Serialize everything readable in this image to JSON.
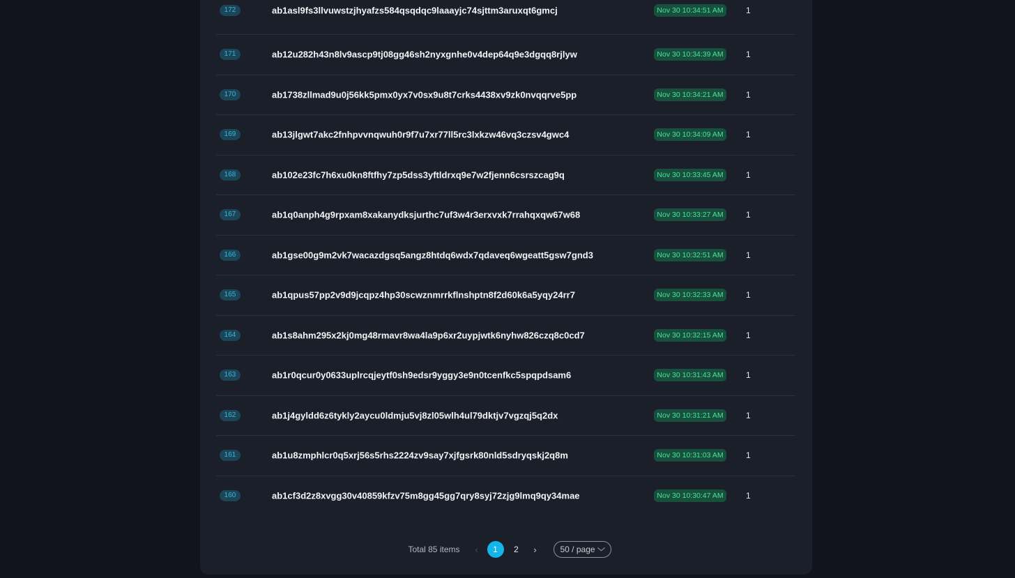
{
  "blocks": [
    {
      "height": "172",
      "hash": "ab1asl9fs3llvuwstzjhyafzs584qsqdqc9laaayjc74sjttm3aruxqt6gmcj",
      "time": "Nov 30 10:34:51 AM",
      "txs": "1"
    },
    {
      "height": "171",
      "hash": "ab12u282h43n8lv9ascp9tj08gg46sh2nyxgnhe0v4dep64q9e3dgqq8rjlyw",
      "time": "Nov 30 10:34:39 AM",
      "txs": "1"
    },
    {
      "height": "170",
      "hash": "ab1738zllmad9u0j56kk5pmx0yx7v0sx9u8t7crks4438xv9zk0nvqqrve5pp",
      "time": "Nov 30 10:34:21 AM",
      "txs": "1"
    },
    {
      "height": "169",
      "hash": "ab13jlgwt7akc2fnhpvvnqwuh0r9f7u7xr77ll5rc3lxkzw46vq3czsv4gwc4",
      "time": "Nov 30 10:34:09 AM",
      "txs": "1"
    },
    {
      "height": "168",
      "hash": "ab102e23fc7h6xu0kn8ftfhy7zp5dss3yftldrxq9e7w2fjenn6csrszcag9q",
      "time": "Nov 30 10:33:45 AM",
      "txs": "1"
    },
    {
      "height": "167",
      "hash": "ab1q0anph4g9rpxam8xakanydksjurthc7uf3w4r3erxvxk7rrahqxqw67w68",
      "time": "Nov 30 10:33:27 AM",
      "txs": "1"
    },
    {
      "height": "166",
      "hash": "ab1gse00g9m2vk7wacazdgsq5angz8htdq6wdx7qdaveq6wgeatt5gsw7gnd3",
      "time": "Nov 30 10:32:51 AM",
      "txs": "1"
    },
    {
      "height": "165",
      "hash": "ab1qpus57pp2v9d9jcqpz4hp30scwznmrrkflnshptn8f2d60k6a5yqy24rr7",
      "time": "Nov 30 10:32:33 AM",
      "txs": "1"
    },
    {
      "height": "164",
      "hash": "ab1s8ahm295x2kj0mg48rmavr8wa4la9p6xr2uypjwtk6nyhw826czq8c0cd7",
      "time": "Nov 30 10:32:15 AM",
      "txs": "1"
    },
    {
      "height": "163",
      "hash": "ab1r0qcur0y0633uplrcqjeytf0sh9edsr9yggy3e9n0tcenfkc5spqpdsam6",
      "time": "Nov 30 10:31:43 AM",
      "txs": "1"
    },
    {
      "height": "162",
      "hash": "ab1j4gyldd6z6tykly2aycu0ldmju5vj8zl05wlh4ul79dktjv7vgzqj5q2dx",
      "time": "Nov 30 10:31:21 AM",
      "txs": "1"
    },
    {
      "height": "161",
      "hash": "ab1u8zmphlcr0q5xrj56s5rhs2224zv9say7xjfgsrk80nld5sdryqskj2q8m",
      "time": "Nov 30 10:31:03 AM",
      "txs": "1"
    },
    {
      "height": "160",
      "hash": "ab1cf3d2z8xvgg30v40859kfzv75m8gg45gg7qry8syj72zjg9lmq9qy34mae",
      "time": "Nov 30 10:30:47 AM",
      "txs": "1"
    }
  ],
  "pagination": {
    "total_label": "Total 85 items",
    "prev_icon": "‹",
    "next_icon": "›",
    "pages": [
      "1",
      "2"
    ],
    "active_page": "1",
    "page_size_label": "50 / page",
    "page_size_icon": "chevron-down-icon"
  },
  "colors": {
    "background": "#11141c",
    "panel": "#1b1f29",
    "height_badge_bg": "#1c4557",
    "height_badge_text": "#39b4df",
    "time_badge_bg": "#17503c",
    "time_badge_text": "#4ee09d",
    "active_page": "#13b5ea"
  }
}
